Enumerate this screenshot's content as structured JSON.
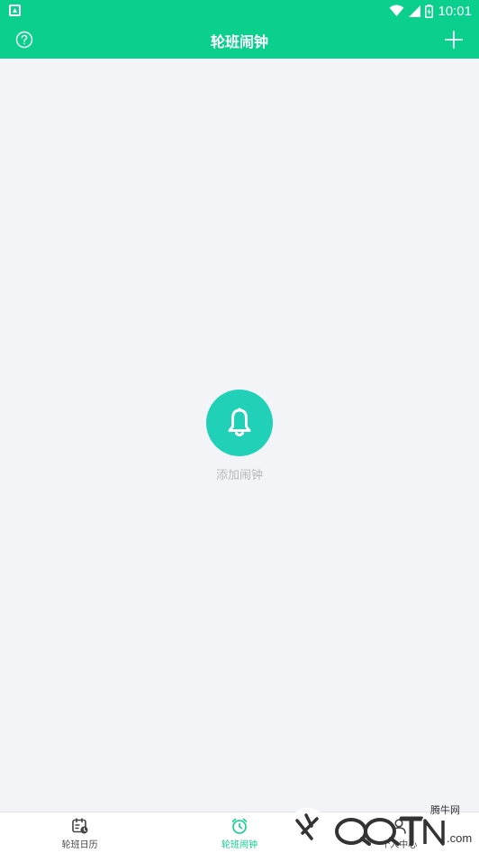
{
  "status_bar": {
    "time": "10:01"
  },
  "header": {
    "title": "轮班闹钟",
    "help_icon": "question-circle-icon",
    "add_icon": "plus-icon"
  },
  "empty_state": {
    "icon": "bell-icon",
    "label": "添加闹钟"
  },
  "bottom_nav": {
    "items": [
      {
        "label": "轮班日历",
        "icon": "calendar-icon",
        "active": false
      },
      {
        "label": "轮班闹钟",
        "icon": "alarm-clock-icon",
        "active": true
      },
      {
        "label": "个人中心",
        "icon": "user-icon",
        "active": false
      }
    ]
  },
  "watermark": {
    "site_name": "腾牛网",
    "logo_text": "QQTN.com"
  },
  "colors": {
    "primary": "#0bcf8c",
    "bell_circle": "#21d1b7",
    "background": "#f3f4f8",
    "muted_text": "#b8b8b8"
  }
}
